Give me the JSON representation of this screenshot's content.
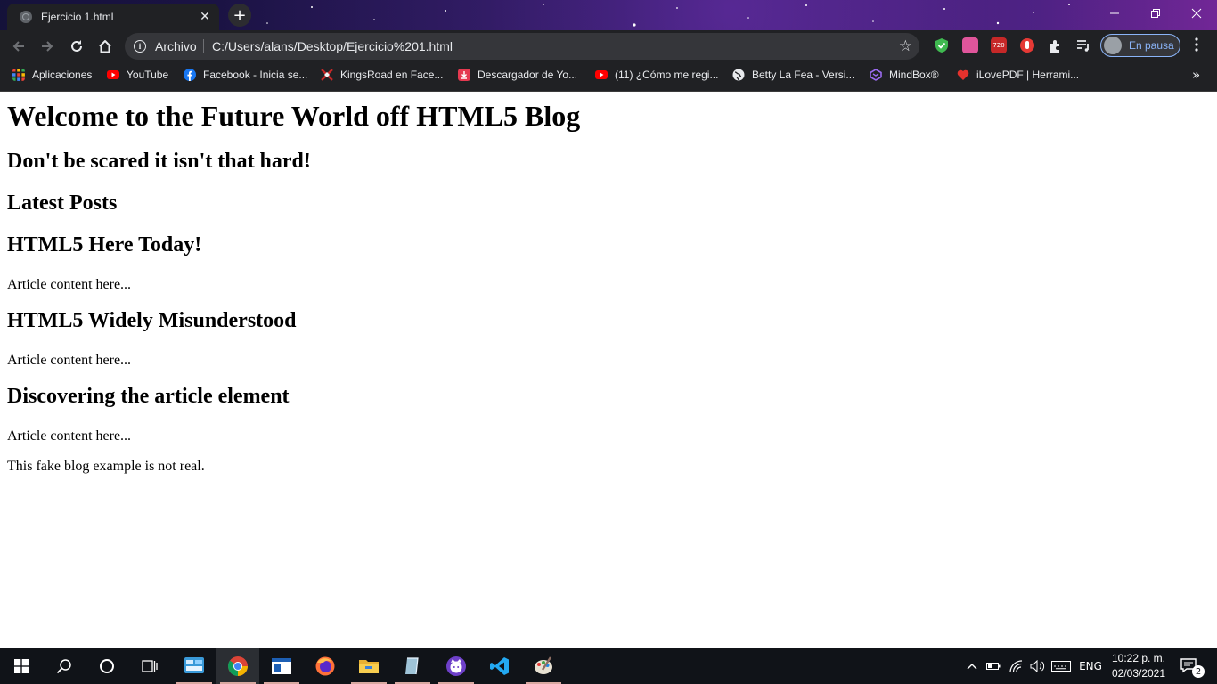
{
  "browser": {
    "tab_title": "Ejercicio 1.html",
    "tab_close": "✕",
    "new_tab": "+",
    "window_controls": {
      "minimize": "—",
      "restore": "❐",
      "close": "✕"
    },
    "address": {
      "scheme_label": "Archivo",
      "url": "C:/Users/alans/Desktop/Ejercicio%201.html",
      "info_glyph": "i",
      "bookmark_star": "☆"
    },
    "profile": {
      "label": "En pausa"
    },
    "menu_glyph": "⋮"
  },
  "bookmarks": [
    {
      "label": "Aplicaciones",
      "icon": "apps-grid-icon",
      "color": "#ea4335"
    },
    {
      "label": "YouTube",
      "icon": "youtube-icon",
      "color": "#ff0000"
    },
    {
      "label": "Facebook - Inicia se...",
      "icon": "facebook-icon",
      "color": "#1877f2"
    },
    {
      "label": "KingsRoad en Face...",
      "icon": "kingsroad-icon",
      "color": "#c62828"
    },
    {
      "label": "Descargador de Yo...",
      "icon": "download-icon",
      "color": "#e53950"
    },
    {
      "label": "(11) ¿Cómo me regi...",
      "icon": "youtube-icon",
      "color": "#ff0000"
    },
    {
      "label": "Betty La Fea - Versi...",
      "icon": "globe-icon",
      "color": "#e8eaed"
    },
    {
      "label": "MindBox®",
      "icon": "mindbox-icon",
      "color": "#7b4bd6"
    },
    {
      "label": "iLovePDF | Herrami...",
      "icon": "ilovepdf-icon",
      "color": "#e5322d"
    }
  ],
  "bookmarks_overflow": "»",
  "page": {
    "h1": "Welcome to the Future World off HTML5 Blog",
    "subtitle": "Don't be scared it isn't that hard!",
    "section_title": "Latest Posts",
    "articles": [
      {
        "title": "HTML5 Here Today!",
        "content": "Article content here..."
      },
      {
        "title": "HTML5 Widely Misunderstood",
        "content": "Article content here..."
      },
      {
        "title": "Discovering the article element",
        "content": "Article content here..."
      }
    ],
    "footer": "This fake blog example is not real."
  },
  "taskbar": {
    "apps": [
      "windows-start-icon",
      "search-icon",
      "cortana-icon",
      "task-view-icon",
      "control-panel-icon",
      "chrome-icon",
      "window-app-icon",
      "firefox-icon",
      "file-explorer-icon",
      "notepad-icon",
      "github-icon",
      "vscode-icon",
      "paint-icon"
    ],
    "tray": {
      "language": "ENG",
      "time": "10:22 p. m.",
      "date": "02/03/2021",
      "notifications": "2"
    }
  },
  "colors": {
    "chrome_dark": "#202124",
    "omnibox": "#35363a",
    "accent_blue": "#8ab4f8",
    "taskbar": "#101318"
  }
}
